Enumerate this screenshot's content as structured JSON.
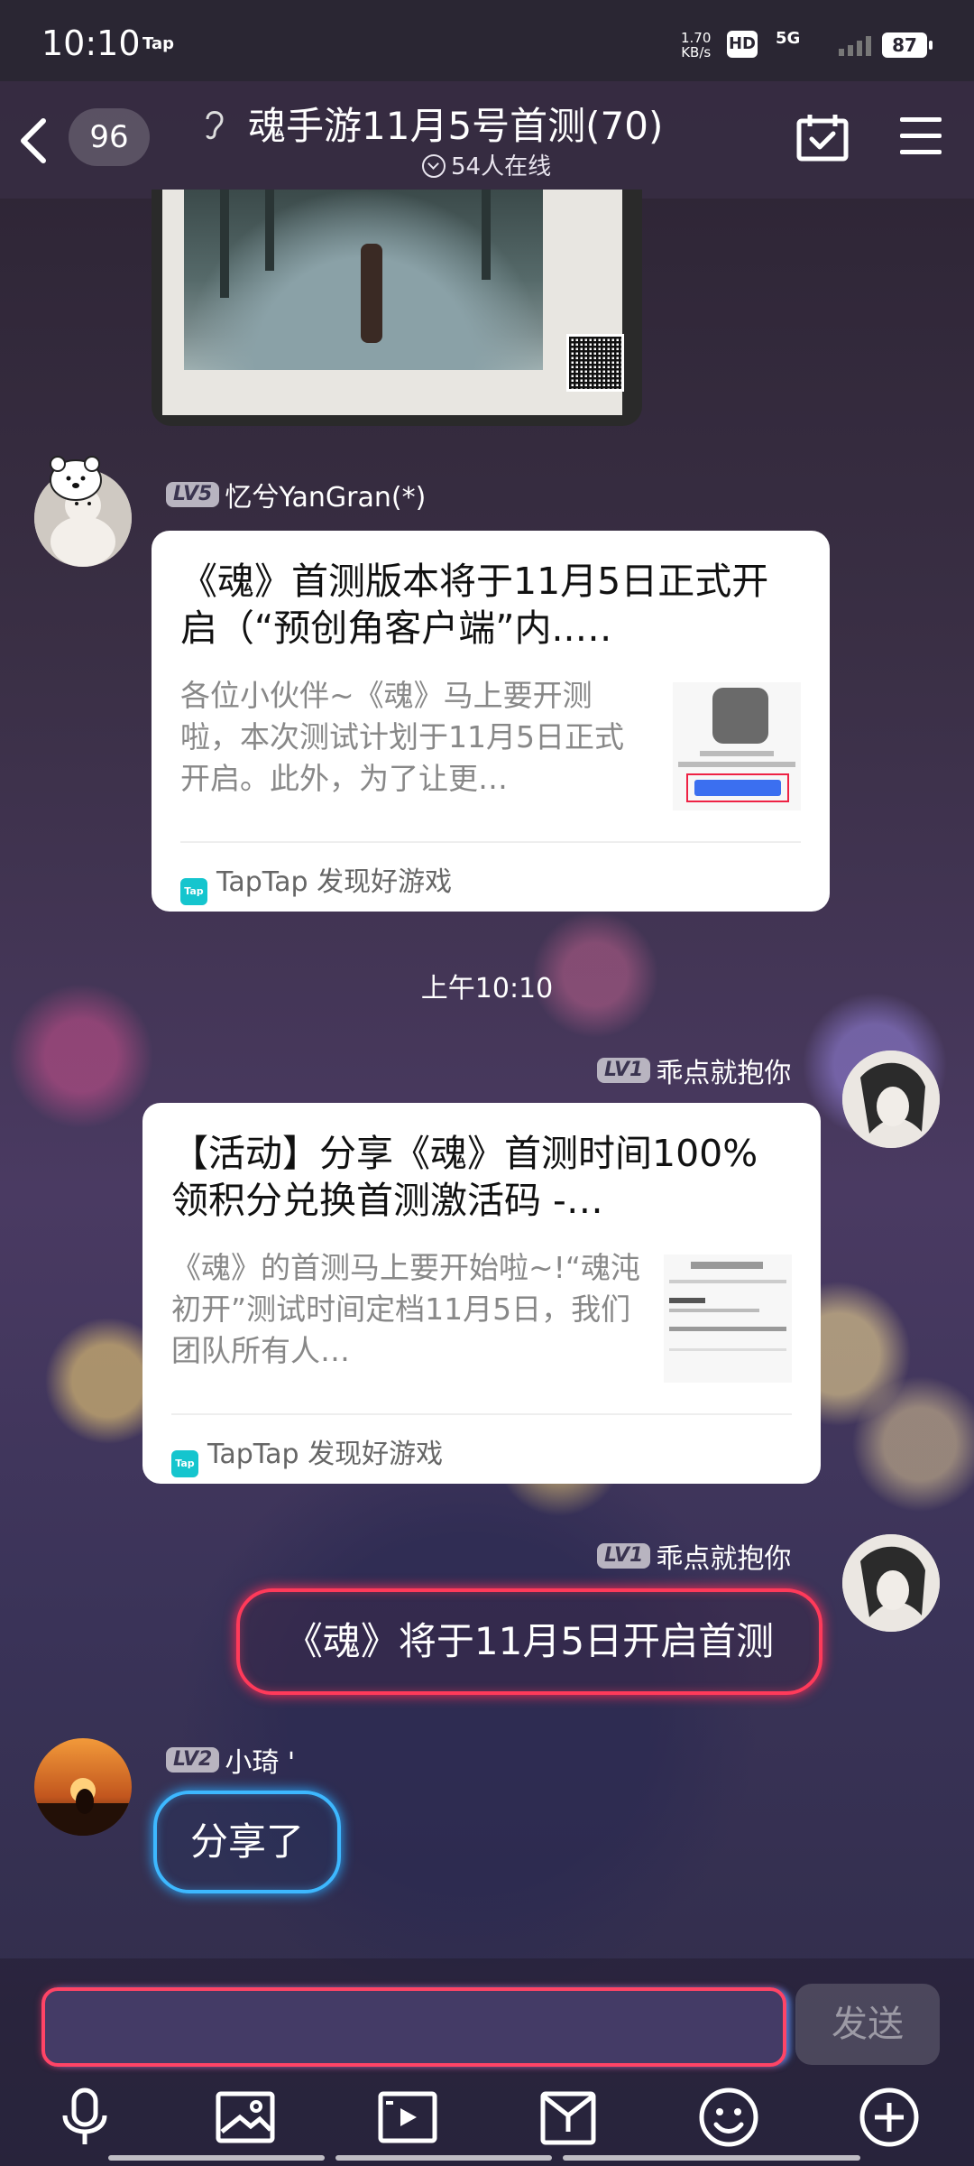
{
  "status_bar": {
    "time": "10:10",
    "app_indicator": "Tap",
    "net_speed_value": "1.70",
    "net_speed_unit": "KB/s",
    "hd_label": "HD",
    "network": "5G",
    "battery": "87"
  },
  "header": {
    "unread_count": "96",
    "title": "魂手游11月5号首测(70)",
    "online_text": "54人在线"
  },
  "messages": [
    {
      "type": "image"
    },
    {
      "type": "link_card",
      "level": "LV5",
      "username": "忆兮YanGran(*)",
      "title": "《魂》首测版本将于11月5日正式开启（“预创角客户端”内..…",
      "description": "各位小伙伴~《魂》马上要开测啦，本次测试计划于11月5日正式开启。此外，为了让更…",
      "source": "TapTap 发现好游戏"
    },
    {
      "type": "timestamp",
      "text": "上午10:10"
    },
    {
      "type": "link_card",
      "level": "LV1",
      "username": "乖点就抱你",
      "title": "【活动】分享《魂》首测时间100%领积分兑换首测激活码 -…",
      "description": "《魂》的首测马上要开始啦~!“魂沌初开”测试时间定档11月5日，我们团队所有人…",
      "source": "TapTap 发现好游戏"
    },
    {
      "type": "text",
      "level": "LV1",
      "username": "乖点就抱你",
      "text": "《魂》将于11月5日开启首测"
    },
    {
      "type": "text",
      "level": "LV2",
      "username": "小琦 '",
      "text": "分享了"
    }
  ],
  "input": {
    "placeholder": "",
    "send_label": "发送"
  },
  "toolbar": [
    "microphone-icon",
    "image-icon",
    "video-icon",
    "gift-bag-icon",
    "emoji-icon",
    "plus-icon"
  ],
  "colors": {
    "red_neon": "#ff3a5a",
    "blue_neon": "#3db8ff",
    "tap_brand": "#15c5ce"
  }
}
